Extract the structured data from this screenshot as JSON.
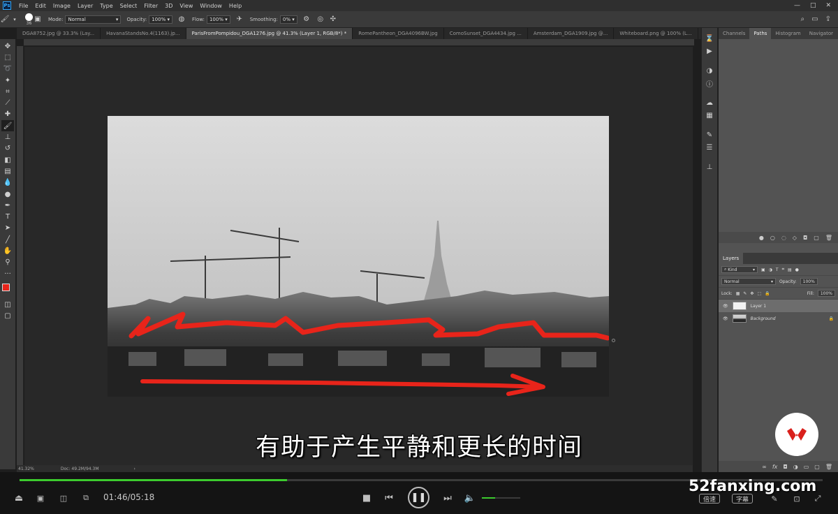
{
  "menubar": {
    "app_icon": "Ps",
    "items": [
      "File",
      "Edit",
      "Image",
      "Layer",
      "Type",
      "Select",
      "Filter",
      "3D",
      "View",
      "Window",
      "Help"
    ]
  },
  "options": {
    "brush_size": "36",
    "mode_label": "Mode:",
    "mode_value": "Normal",
    "opacity_label": "Opacity:",
    "opacity_value": "100%",
    "flow_label": "Flow:",
    "flow_value": "100%",
    "smoothing_label": "Smoothing:",
    "smoothing_value": "0%"
  },
  "tabs": [
    "DGA8752.jpg @ 33.3% (Lay...",
    "HavanaStandsNo.4(1163).jp...",
    "ParisFromPompidou_DGA1276.jpg @ 41.3% (Layer 1, RGB/8*) *",
    "RomePantheon_DGA4096BW.jpg",
    "ComoSunset_DGA4434.jpg ...",
    "Amsterdam_DGA1909.jpg @...",
    "Whiteboard.png @ 100% (L..."
  ],
  "tab_more": "»",
  "status": {
    "zoom": "41.32%",
    "doc": "Doc: 49.2M/94.3M",
    "arrow": "›"
  },
  "panels": {
    "top_tabs": [
      "Channels",
      "Paths",
      "Histogram",
      "Navigator"
    ],
    "layers_title": "Layers",
    "kind_label": "Kind",
    "blend_mode": "Normal",
    "opacity_label": "Opacity:",
    "opacity_value": "100%",
    "lock_label": "Lock:",
    "fill_label": "Fill:",
    "fill_value": "100%",
    "layers": [
      {
        "name": "Layer 1",
        "selected": true
      },
      {
        "name": "Background",
        "selected": false
      }
    ],
    "footer_fx": "fx"
  },
  "subtitle": "有助于产生平静和更长的时间",
  "player": {
    "time": "01:46/05:18",
    "progress": 0.333,
    "volume": 0.35,
    "speed_label": "倍速",
    "subtitle_label": "字幕"
  },
  "watermark_site": "52fanxing.com",
  "colors": {
    "foreground": "#e8241a",
    "background": "#ffffff",
    "progress": "#3ccb2e",
    "logo_red": "#d9201c"
  }
}
